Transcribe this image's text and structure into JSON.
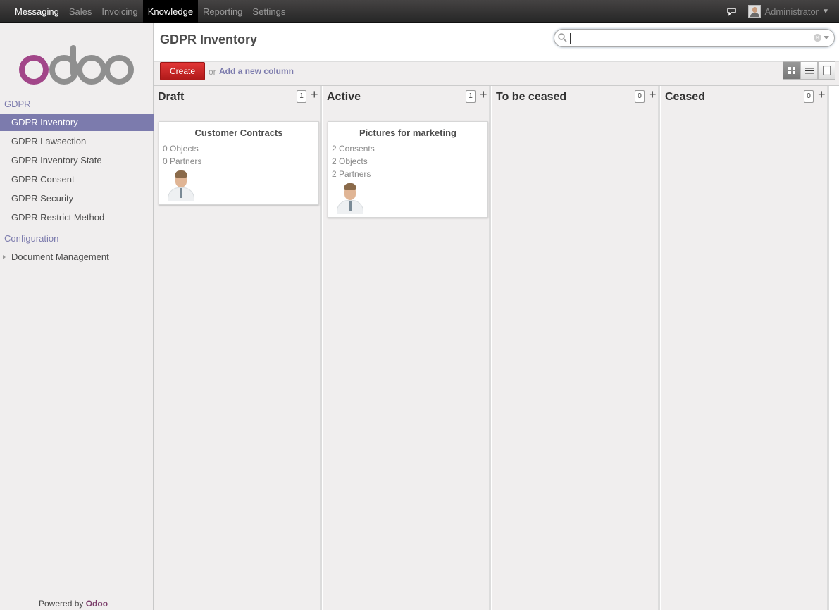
{
  "topbar": {
    "menu": [
      "Messaging",
      "Sales",
      "Invoicing",
      "Knowledge",
      "Reporting",
      "Settings"
    ],
    "active_index": 3,
    "user": "Administrator"
  },
  "sidebar": {
    "section1": "GDPR",
    "items": [
      "GDPR Inventory",
      "GDPR Lawsection",
      "GDPR Inventory State",
      "GDPR Consent",
      "GDPR Security",
      "GDPR Restrict Method"
    ],
    "active_index": 0,
    "section2": "Configuration",
    "config_items": [
      "Document Management"
    ],
    "powered_prefix": "Powered by",
    "powered_brand": "Odoo"
  },
  "header": {
    "title": "GDPR Inventory",
    "create_label": "Create",
    "or_text": "or",
    "add_column_label": "Add a new column"
  },
  "columns": [
    {
      "title": "Draft",
      "count": "1",
      "cards": [
        {
          "title": "Customer Contracts",
          "lines": [
            "0 Objects",
            "0 Partners"
          ]
        }
      ]
    },
    {
      "title": "Active",
      "count": "1",
      "cards": [
        {
          "title": "Pictures for marketing",
          "lines": [
            "2 Consents",
            "2 Objects",
            "2 Partners"
          ]
        }
      ]
    },
    {
      "title": "To be ceased",
      "count": "0",
      "cards": []
    },
    {
      "title": "Ceased",
      "count": "0",
      "cards": []
    }
  ],
  "colors": {
    "accent": "#7c7bad",
    "create": "#c82828",
    "brand": "#7c3e6b"
  },
  "icons": [
    "chat-icon",
    "search-icon",
    "clear-icon",
    "kanban-view-icon",
    "list-view-icon",
    "form-view-icon"
  ]
}
